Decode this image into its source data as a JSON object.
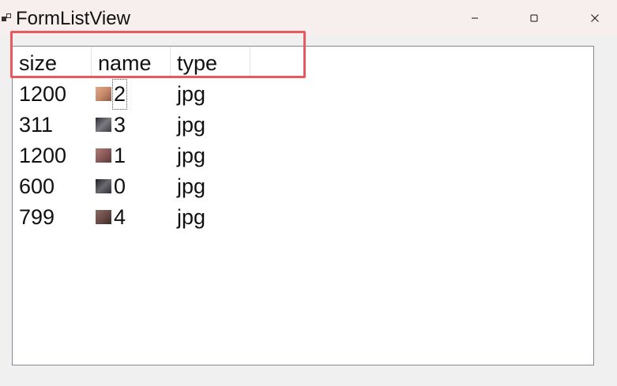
{
  "window": {
    "title": "FormListView"
  },
  "controls": {
    "minimize_icon": "minimize-icon",
    "maximize_icon": "maximize-icon",
    "close_icon": "close-icon"
  },
  "listview": {
    "columns": [
      "size",
      "name",
      "type"
    ],
    "rows": [
      {
        "size": "1200",
        "name": "2",
        "type": "jpg",
        "thumb_color": "#c98a6c"
      },
      {
        "size": "311",
        "name": "3",
        "type": "jpg",
        "thumb_color": "#4a4a50"
      },
      {
        "size": "1200",
        "name": "1",
        "type": "jpg",
        "thumb_color": "#8a5a58"
      },
      {
        "size": "600",
        "name": "0",
        "type": "jpg",
        "thumb_color": "#3c3c42"
      },
      {
        "size": "799",
        "name": "4",
        "type": "jpg",
        "thumb_color": "#6a4c48"
      }
    ]
  },
  "colors": {
    "highlight": "#e8585e",
    "titlebar": "#f7efee"
  }
}
